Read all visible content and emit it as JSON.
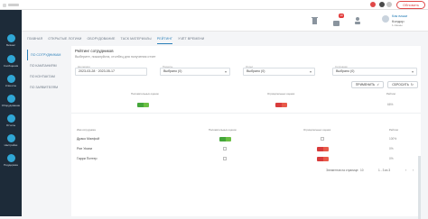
{
  "browser": {
    "url_pill": "Обновить"
  },
  "sidebar": {
    "items": [
      {
        "label": "Бизнес",
        "icon": "briefcase-icon"
      },
      {
        "label": "Сообщения",
        "icon": "chat-icon"
      },
      {
        "label": "Клиенты",
        "icon": "people-icon"
      },
      {
        "label": "Оборудование",
        "icon": "gear-icon"
      },
      {
        "label": "Отчеты",
        "icon": "chart-icon"
      },
      {
        "label": "Настройки",
        "icon": "settings-icon"
      },
      {
        "label": "Поддержка",
        "icon": "help-icon"
      }
    ]
  },
  "header": {
    "badge_count": "10",
    "user": {
      "name": "Как ваши",
      "role": "Кондор",
      "sub": "1 смены"
    }
  },
  "tabs": [
    "ГЛАВНАЯ",
    "ОТКРЫТЫЕ ЛОГИКИ",
    "ОБОРУДОВАНИЕ",
    "ТАСК МАТЕРИАЛЫ",
    "РЕЙТИНГ",
    "УЧЁТ ВРЕМЕНИ"
  ],
  "active_tab": 4,
  "subnav": [
    "ПО СОТРУДНИКАМ",
    "ПО КАМПАНИЯМ",
    "ПО КОНТАКТАМ",
    "ПО ЗАЯВИТЕЛЯМ"
  ],
  "card": {
    "title": "Рейтинг сотрудников",
    "subtitle": "Выберите, пожалуйста, столбец для получения отчет",
    "filters": [
      {
        "label": "На период",
        "value": "2023-03-28 · 2023-05-17"
      },
      {
        "label": "Проекты",
        "value": "Выбрано (0)"
      },
      {
        "label": "Отдел",
        "value": "Выбрано (0)"
      },
      {
        "label": "Сотрудник",
        "value": "Выбрано (0)"
      }
    ],
    "apply_label": "ПРИМЕНИТЬ",
    "reset_label": "СБРОСИТЬ",
    "summary_headers": [
      "Положительных оценок",
      "Отрицательных оценок",
      "Рейтинг"
    ],
    "summary_values": {
      "positive": "2",
      "negative": "1",
      "rating": "66%"
    },
    "table_headers": [
      "Имя сотрудника",
      "Положительных оценок",
      "Отрицательных оценок",
      "Рейтинг"
    ],
    "rows": [
      {
        "name": "Драко Малфой",
        "positive": "2",
        "negative": "",
        "rating": "100%"
      },
      {
        "name": "Рон Уизли",
        "positive": "",
        "negative": "1",
        "rating": "0%"
      },
      {
        "name": "Гарри Поттер",
        "positive": "",
        "negative": "",
        "rating": "0%"
      }
    ],
    "pager": {
      "per_page_label": "Элементов на странице:",
      "per_page": "10",
      "range": "1 - 3 из 3"
    }
  },
  "colors": {
    "accent": "#2a7fb8",
    "sidebar": "#1d2b39",
    "positive": "#44a63a",
    "negative": "#d83c3c"
  }
}
